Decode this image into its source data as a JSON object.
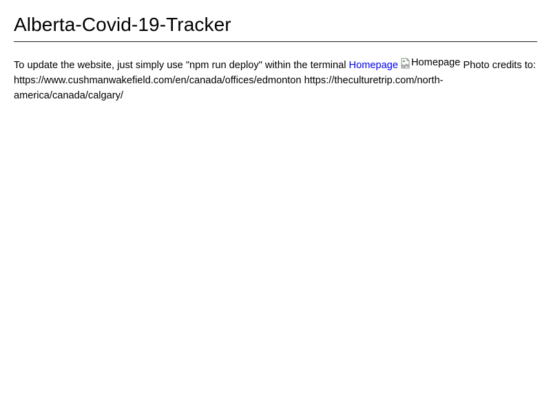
{
  "readme": {
    "title": "Alberta-Covid-19-Tracker",
    "deploy_text": "To update the website, just simply use \"npm run deploy\" within the terminal",
    "homepage_link": "Homepage",
    "homepage_image_alt": "Homepage",
    "credits_label": "Photo credits to:",
    "credit_url_1": "https://www.cushmanwakefield.com/en/canada/offices/edmonton",
    "credit_url_2": "https://theculturetrip.com/north-america/canada/calgary/"
  }
}
